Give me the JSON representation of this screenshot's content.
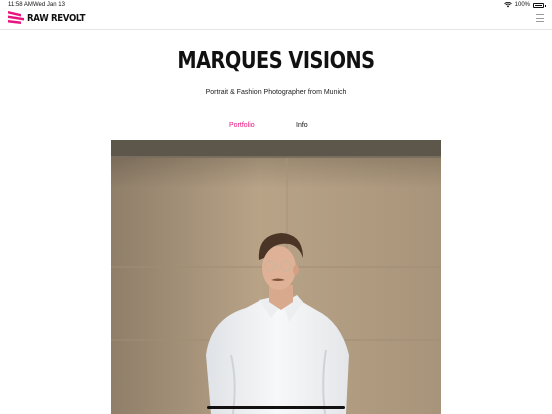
{
  "status_bar": {
    "time": "11:58 AM",
    "date": "Wed Jan 13",
    "battery": "100%"
  },
  "header": {
    "logo_text": "RAW REVOLT",
    "logo_icon": "stripes-logo",
    "menu_icon": "hamburger-menu-icon"
  },
  "hero": {
    "title": "MARQUES VISIONS",
    "subtitle": "Portrait & Fashion Photographer from Munich"
  },
  "tabs": [
    {
      "label": "Portfolio",
      "active": true
    },
    {
      "label": "Info",
      "active": false
    }
  ],
  "colors": {
    "accent": "#e8157f",
    "photo_wall": "#b59f83",
    "shirt": "#f2f3f4"
  }
}
